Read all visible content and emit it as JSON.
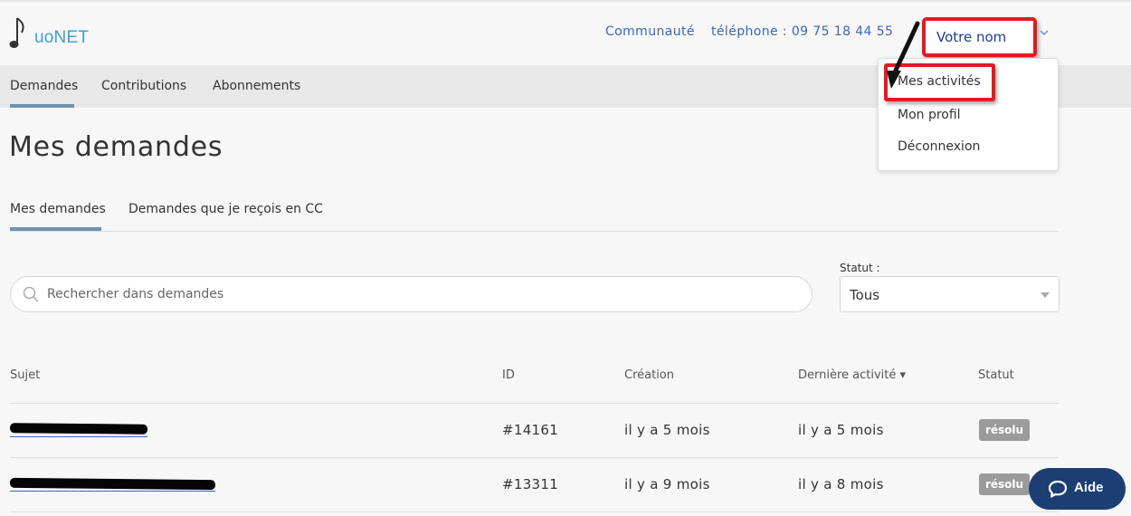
{
  "header": {
    "logo_text": "uoNET",
    "links": {
      "community": "Communauté",
      "phone": "téléphone : 09 75 18 44 55"
    },
    "user_name": "Votre nom"
  },
  "nav": {
    "items": [
      {
        "label": "Demandes"
      },
      {
        "label": "Contributions"
      },
      {
        "label": "Abonnements"
      }
    ]
  },
  "user_menu": {
    "items": [
      {
        "label": "Mes activités"
      },
      {
        "label": "Mon profil"
      },
      {
        "label": "Déconnexion"
      }
    ]
  },
  "page": {
    "title": "Mes demandes",
    "tabs": [
      {
        "label": "Mes demandes"
      },
      {
        "label": "Demandes que je reçois en CC"
      }
    ]
  },
  "filters": {
    "search_placeholder": "Rechercher dans demandes",
    "status_label": "Statut :",
    "status_value": "Tous"
  },
  "table": {
    "headers": [
      "Sujet",
      "ID",
      "Création",
      "Dernière activité ▾",
      "Statut"
    ],
    "rows": [
      {
        "id": "#14161",
        "created": "il y a 5 mois",
        "last_activity": "il y a 5 mois",
        "status": "résolu"
      },
      {
        "id": "#13311",
        "created": "il y a 9 mois",
        "last_activity": "il y a 8 mois",
        "status": "résolu"
      }
    ]
  },
  "help": {
    "label": "Aide"
  },
  "colors": {
    "accent_blue": "#3f66b5",
    "highlight_red": "#e01b22",
    "help_button": "#1d3e73",
    "tab_underline": "#6d93ad",
    "badge_grey": "#9b9b9b"
  }
}
